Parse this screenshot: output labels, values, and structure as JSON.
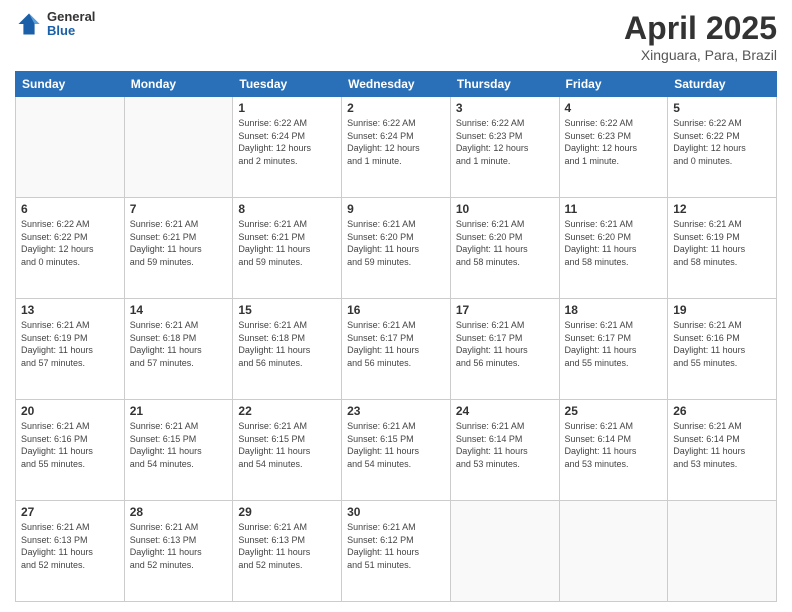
{
  "header": {
    "logo": {
      "general": "General",
      "blue": "Blue"
    },
    "title": "April 2025",
    "subtitle": "Xinguara, Para, Brazil"
  },
  "calendar": {
    "days_of_week": [
      "Sunday",
      "Monday",
      "Tuesday",
      "Wednesday",
      "Thursday",
      "Friday",
      "Saturday"
    ],
    "weeks": [
      [
        {
          "day": "",
          "info": ""
        },
        {
          "day": "",
          "info": ""
        },
        {
          "day": "1",
          "info": "Sunrise: 6:22 AM\nSunset: 6:24 PM\nDaylight: 12 hours\nand 2 minutes."
        },
        {
          "day": "2",
          "info": "Sunrise: 6:22 AM\nSunset: 6:24 PM\nDaylight: 12 hours\nand 1 minute."
        },
        {
          "day": "3",
          "info": "Sunrise: 6:22 AM\nSunset: 6:23 PM\nDaylight: 12 hours\nand 1 minute."
        },
        {
          "day": "4",
          "info": "Sunrise: 6:22 AM\nSunset: 6:23 PM\nDaylight: 12 hours\nand 1 minute."
        },
        {
          "day": "5",
          "info": "Sunrise: 6:22 AM\nSunset: 6:22 PM\nDaylight: 12 hours\nand 0 minutes."
        }
      ],
      [
        {
          "day": "6",
          "info": "Sunrise: 6:22 AM\nSunset: 6:22 PM\nDaylight: 12 hours\nand 0 minutes."
        },
        {
          "day": "7",
          "info": "Sunrise: 6:21 AM\nSunset: 6:21 PM\nDaylight: 11 hours\nand 59 minutes."
        },
        {
          "day": "8",
          "info": "Sunrise: 6:21 AM\nSunset: 6:21 PM\nDaylight: 11 hours\nand 59 minutes."
        },
        {
          "day": "9",
          "info": "Sunrise: 6:21 AM\nSunset: 6:20 PM\nDaylight: 11 hours\nand 59 minutes."
        },
        {
          "day": "10",
          "info": "Sunrise: 6:21 AM\nSunset: 6:20 PM\nDaylight: 11 hours\nand 58 minutes."
        },
        {
          "day": "11",
          "info": "Sunrise: 6:21 AM\nSunset: 6:20 PM\nDaylight: 11 hours\nand 58 minutes."
        },
        {
          "day": "12",
          "info": "Sunrise: 6:21 AM\nSunset: 6:19 PM\nDaylight: 11 hours\nand 58 minutes."
        }
      ],
      [
        {
          "day": "13",
          "info": "Sunrise: 6:21 AM\nSunset: 6:19 PM\nDaylight: 11 hours\nand 57 minutes."
        },
        {
          "day": "14",
          "info": "Sunrise: 6:21 AM\nSunset: 6:18 PM\nDaylight: 11 hours\nand 57 minutes."
        },
        {
          "day": "15",
          "info": "Sunrise: 6:21 AM\nSunset: 6:18 PM\nDaylight: 11 hours\nand 56 minutes."
        },
        {
          "day": "16",
          "info": "Sunrise: 6:21 AM\nSunset: 6:17 PM\nDaylight: 11 hours\nand 56 minutes."
        },
        {
          "day": "17",
          "info": "Sunrise: 6:21 AM\nSunset: 6:17 PM\nDaylight: 11 hours\nand 56 minutes."
        },
        {
          "day": "18",
          "info": "Sunrise: 6:21 AM\nSunset: 6:17 PM\nDaylight: 11 hours\nand 55 minutes."
        },
        {
          "day": "19",
          "info": "Sunrise: 6:21 AM\nSunset: 6:16 PM\nDaylight: 11 hours\nand 55 minutes."
        }
      ],
      [
        {
          "day": "20",
          "info": "Sunrise: 6:21 AM\nSunset: 6:16 PM\nDaylight: 11 hours\nand 55 minutes."
        },
        {
          "day": "21",
          "info": "Sunrise: 6:21 AM\nSunset: 6:15 PM\nDaylight: 11 hours\nand 54 minutes."
        },
        {
          "day": "22",
          "info": "Sunrise: 6:21 AM\nSunset: 6:15 PM\nDaylight: 11 hours\nand 54 minutes."
        },
        {
          "day": "23",
          "info": "Sunrise: 6:21 AM\nSunset: 6:15 PM\nDaylight: 11 hours\nand 54 minutes."
        },
        {
          "day": "24",
          "info": "Sunrise: 6:21 AM\nSunset: 6:14 PM\nDaylight: 11 hours\nand 53 minutes."
        },
        {
          "day": "25",
          "info": "Sunrise: 6:21 AM\nSunset: 6:14 PM\nDaylight: 11 hours\nand 53 minutes."
        },
        {
          "day": "26",
          "info": "Sunrise: 6:21 AM\nSunset: 6:14 PM\nDaylight: 11 hours\nand 53 minutes."
        }
      ],
      [
        {
          "day": "27",
          "info": "Sunrise: 6:21 AM\nSunset: 6:13 PM\nDaylight: 11 hours\nand 52 minutes."
        },
        {
          "day": "28",
          "info": "Sunrise: 6:21 AM\nSunset: 6:13 PM\nDaylight: 11 hours\nand 52 minutes."
        },
        {
          "day": "29",
          "info": "Sunrise: 6:21 AM\nSunset: 6:13 PM\nDaylight: 11 hours\nand 52 minutes."
        },
        {
          "day": "30",
          "info": "Sunrise: 6:21 AM\nSunset: 6:12 PM\nDaylight: 11 hours\nand 51 minutes."
        },
        {
          "day": "",
          "info": ""
        },
        {
          "day": "",
          "info": ""
        },
        {
          "day": "",
          "info": ""
        }
      ]
    ]
  }
}
